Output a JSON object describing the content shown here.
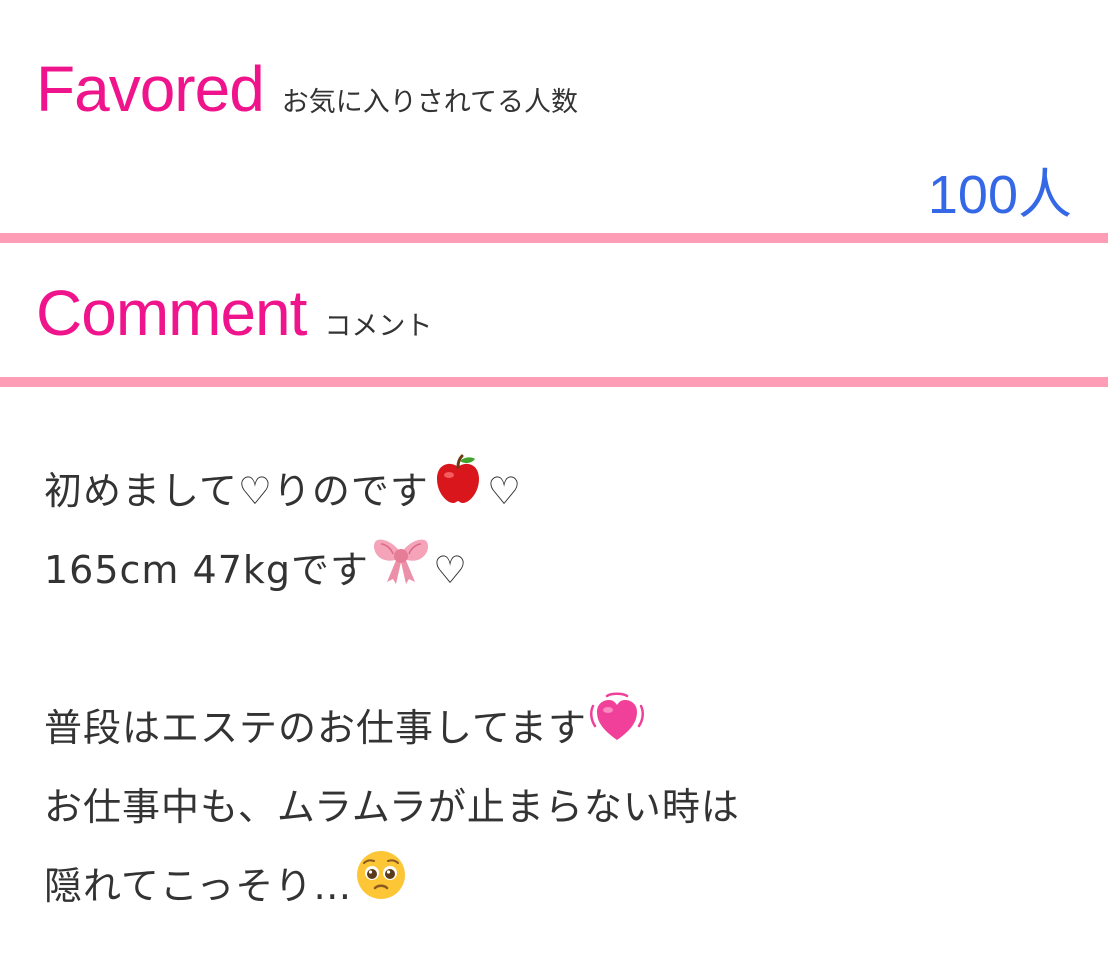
{
  "favored": {
    "title_en": "Favored",
    "title_jp": "お気に入りされてる人数",
    "count": "100人"
  },
  "comment": {
    "title_en": "Comment",
    "title_jp": "コメント",
    "lines": [
      {
        "text": "初めまして♡りのです",
        "emoji": "apple-emoji",
        "suffix": "♡"
      },
      {
        "text": "165cm 47kgです",
        "emoji": "ribbon-emoji",
        "suffix": "♡"
      },
      {
        "text": "",
        "emoji": "",
        "suffix": ""
      },
      {
        "text": "普段はエステのお仕事してます",
        "emoji": "beating-heart-emoji",
        "suffix": ""
      },
      {
        "text": "お仕事中も、ムラムラが止まらない時は",
        "emoji": "",
        "suffix": ""
      },
      {
        "text": "隠れてこっそり…",
        "emoji": "pleading-face-emoji",
        "suffix": ""
      }
    ]
  },
  "colors": {
    "accent_pink": "#f0148c",
    "divider_pink": "#ff9db6",
    "count_blue": "#3468e6",
    "text_dark": "#333333"
  }
}
